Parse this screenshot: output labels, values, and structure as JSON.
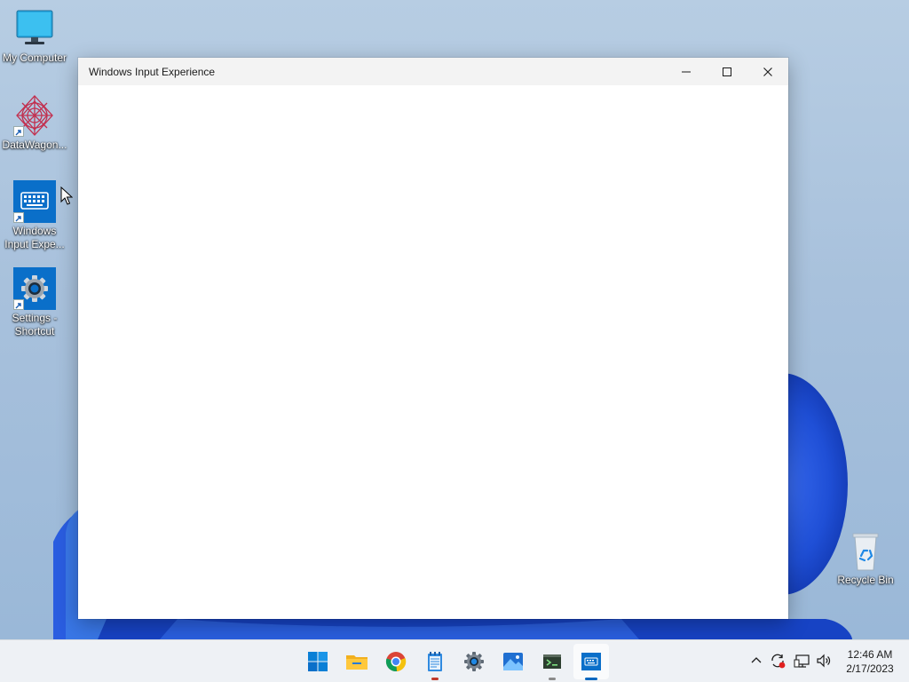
{
  "desktop": {
    "icons": [
      {
        "label": "My Computer",
        "icon": "monitor-icon"
      },
      {
        "label": "DataWagon...",
        "icon": "datawagon-icon",
        "shortcut": true
      },
      {
        "label": "Windows Input Expe...",
        "icon": "keyboard-icon",
        "shortcut": true
      },
      {
        "label": "Settings - Shortcut",
        "icon": "gear-icon",
        "shortcut": true
      },
      {
        "label": "Recycle Bin",
        "icon": "recycle-bin-icon"
      }
    ]
  },
  "window": {
    "title": "Windows Input Experience",
    "controls": [
      "minimize",
      "maximize",
      "close"
    ]
  },
  "taskbar": {
    "apps": [
      {
        "name": "Start",
        "icon": "windows-start-icon"
      },
      {
        "name": "File Explorer",
        "icon": "folder-icon"
      },
      {
        "name": "Google Chrome",
        "icon": "chrome-icon"
      },
      {
        "name": "Notepad",
        "icon": "notepad-icon",
        "running": true
      },
      {
        "name": "Settings",
        "icon": "gear-icon"
      },
      {
        "name": "Photos",
        "icon": "photos-icon"
      },
      {
        "name": "Terminal",
        "icon": "terminal-icon",
        "running": true
      },
      {
        "name": "Windows Input Experience",
        "icon": "keyboard-icon",
        "running": true,
        "active": true
      }
    ],
    "tray": {
      "icons": [
        "chevron-up-icon",
        "sync-icon",
        "network-icon",
        "volume-icon"
      ],
      "time": "12:46 AM",
      "date": "2/17/2023"
    }
  },
  "colors": {
    "accent": "#0067c0",
    "wallpaper_bloom": "#1f4fd6"
  }
}
